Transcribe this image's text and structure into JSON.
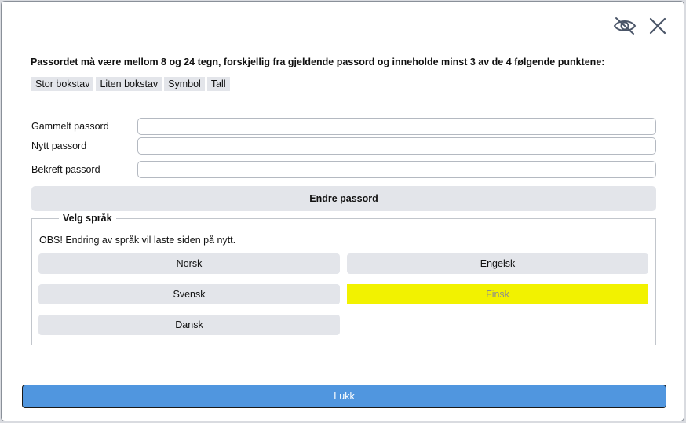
{
  "dialog": {
    "password_rules": "Passordet må være mellom 8 og 24 tegn, forskjellig fra gjeldende passord og inneholde minst 3 av de 4 følgende punktene:",
    "requirements": [
      "Stor bokstav",
      "Liten bokstav",
      "Symbol",
      "Tall"
    ],
    "fields": {
      "old_password_label": "Gammelt passord",
      "new_password_label": "Nytt passord",
      "confirm_password_label": "Bekreft passord",
      "old_password_value": "",
      "new_password_value": "",
      "confirm_password_value": ""
    },
    "change_password_label": "Endre passord",
    "language": {
      "legend": "Velg språk",
      "notice": "OBS! Endring av språk vil laste siden på nytt.",
      "options": [
        "Norsk",
        "Engelsk",
        "Svensk",
        "Finsk",
        "Dansk"
      ],
      "selected": "Finsk",
      "selected_color": "#f2f200"
    },
    "close_label": "Lukk",
    "close_color": "#5096df",
    "icons": [
      "eye-slash-icon",
      "close-icon"
    ]
  }
}
